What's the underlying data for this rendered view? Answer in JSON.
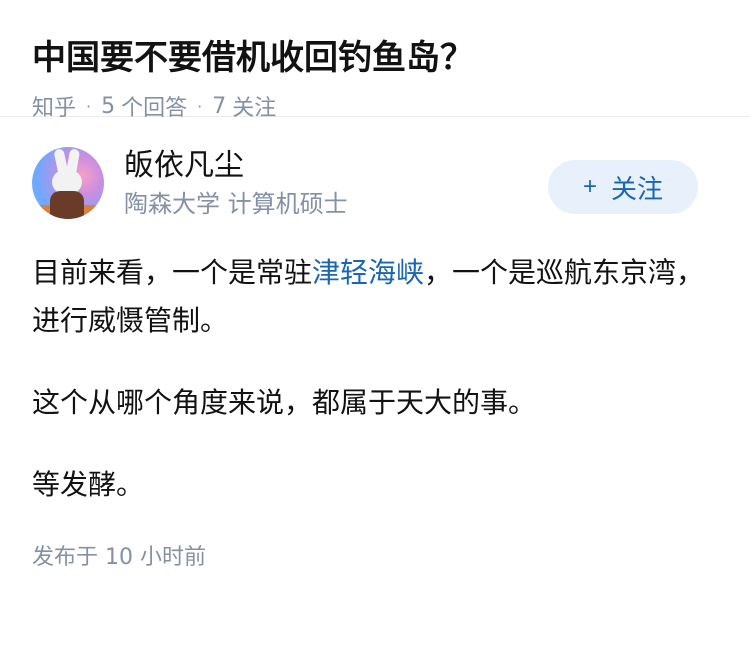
{
  "question": {
    "title": "中国要不要借机收回钓鱼岛？",
    "source": "知乎",
    "answers_count": "5",
    "answers_label": "个回答",
    "followers_count": "7",
    "followers_label": "关注"
  },
  "answer": {
    "author": {
      "name": "皈依凡尘",
      "headline": "陶森大学 计算机硕士"
    },
    "follow_button": {
      "icon": "+",
      "label": "关注"
    },
    "paragraphs": {
      "p1_before": "目前来看，一个是常驻",
      "p1_link": "津轻海峡",
      "p1_after": "，一个是巡航东京湾，进行威慑管制。",
      "p2": "这个从哪个角度来说，都属于天大的事。",
      "p3": "等发酵。"
    },
    "publish_time": "发布于  10 小时前"
  },
  "colors": {
    "link": "#1966b3",
    "meta_gray": "#8590a6",
    "follow_bg": "#e8f1fb"
  }
}
